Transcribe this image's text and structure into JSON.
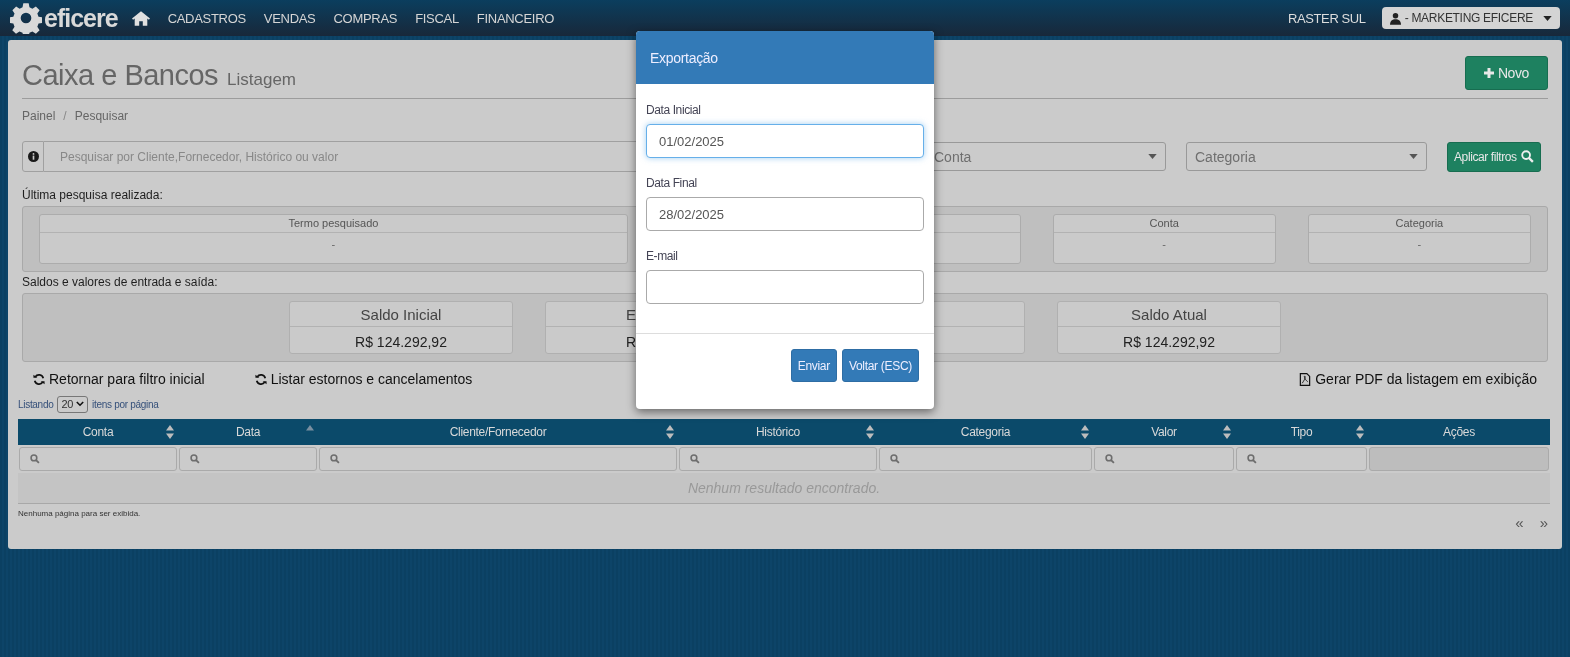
{
  "topbar": {
    "logo": "eficere",
    "menu": [
      "CADASTROS",
      "VENDAS",
      "COMPRAS",
      "FISCAL",
      "FINANCEIRO"
    ],
    "company": "RASTER SUL",
    "user": "- MARKETING EFICERE"
  },
  "page": {
    "title": "Caixa e Bancos",
    "subtitle": "Listagem",
    "new_button": "Novo",
    "breadcrumb": [
      "Painel",
      "Pesquisar"
    ],
    "breadcrumb_separator": "/"
  },
  "filters": {
    "search_placeholder": "Pesquisar por Cliente,Fornecedor, Histórico ou valor",
    "selects": [
      "Conta",
      "Categoria"
    ],
    "apply_button": "Aplicar filtros"
  },
  "last_search": {
    "label": "Última pesquisa realizada:",
    "cards": [
      {
        "kind": "full",
        "title": "Termo pesquisado",
        "value": "-"
      },
      {
        "kind": "covered"
      },
      {
        "kind": "full",
        "title": "Conta",
        "value": "-"
      },
      {
        "kind": "full",
        "title": "Categoria",
        "value": "-"
      }
    ]
  },
  "balances": {
    "label": "Saldos e valores de entrada e saída:",
    "cards": [
      {
        "kind": "full",
        "title": "Saldo Inicial",
        "value": "R$ 124.292,92"
      },
      {
        "kind": "cut",
        "title": "E",
        "value": "R"
      },
      {
        "kind": "covered"
      },
      {
        "kind": "full",
        "title": "Saldo Atual",
        "value": "R$ 124.292,92"
      }
    ]
  },
  "actions": {
    "reset": "Retornar para filtro inicial",
    "reversals": "Listar estornos e cancelamentos",
    "pdf": "Gerar PDF da listagem em exibição"
  },
  "page_size": {
    "prefix": "Listando",
    "value": "20",
    "suffix": "itens por página"
  },
  "table": {
    "columns": [
      {
        "label": "Conta",
        "sortable": true
      },
      {
        "label": "Data",
        "sortable": true,
        "sorted": true
      },
      {
        "label": "Cliente/Fornecedor",
        "sortable": true
      },
      {
        "label": "Histórico",
        "sortable": true
      },
      {
        "label": "Categoria",
        "sortable": true
      },
      {
        "label": "Valor",
        "sortable": true
      },
      {
        "label": "Tipo",
        "sortable": true
      },
      {
        "label": "Ações",
        "sortable": false
      }
    ],
    "empty_message": "Nenhum resultado encontrado."
  },
  "pagination": {
    "info": "Nenhuma página para ser exibida.",
    "prev": "«",
    "next": "»"
  },
  "modal": {
    "title": "Exportação",
    "fields": [
      {
        "label": "Data Inicial",
        "value": "01/02/2025",
        "focused": true
      },
      {
        "label": "Data Final",
        "value": "28/02/2025",
        "focused": false
      },
      {
        "label": "E-mail",
        "focused": false
      }
    ],
    "buttons": [
      "Enviar",
      "Voltar (ESC)"
    ]
  }
}
